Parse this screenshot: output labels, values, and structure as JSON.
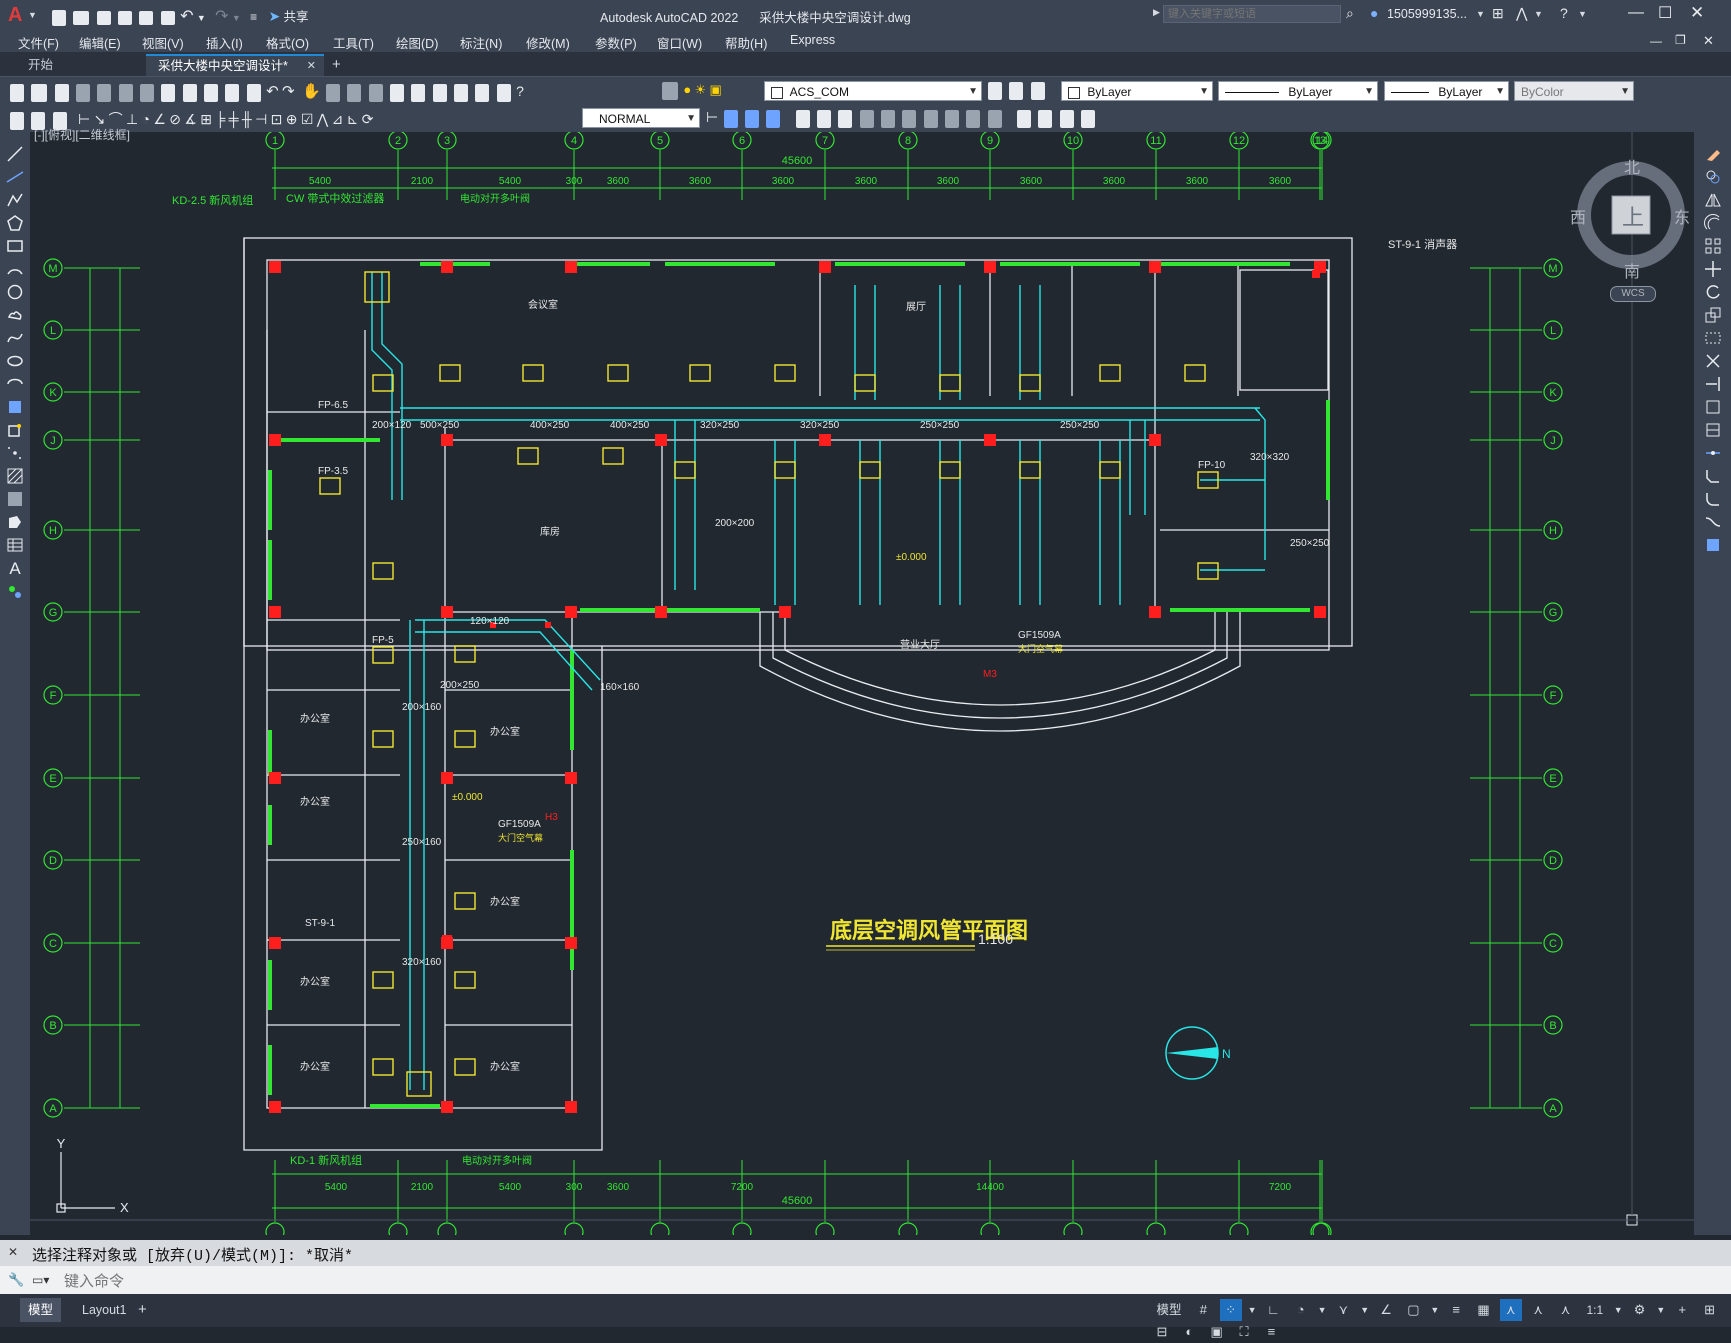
{
  "app": {
    "title": "Autodesk AutoCAD 2022",
    "file": "采供大楼中央空调设计.dwg",
    "share_label": "共享",
    "search_placeholder": "键入关键字或短语",
    "user": "1505999135...",
    "logo": "A"
  },
  "menu": [
    "文件(F)",
    "编辑(E)",
    "视图(V)",
    "插入(I)",
    "格式(O)",
    "工具(T)",
    "绘图(D)",
    "标注(N)",
    "修改(M)",
    "参数(P)",
    "窗口(W)",
    "帮助(H)",
    "Express"
  ],
  "tabs": {
    "start": "开始",
    "active": "采供大楼中央空调设计*",
    "add": "+"
  },
  "toolbar": {
    "layer": "ACS_COM",
    "color": "ByLayer",
    "linetype": "ByLayer",
    "lineweight": "ByLayer",
    "plotstyle": "ByColor",
    "textstyle": "NORMAL"
  },
  "viewport": {
    "label": "[-][俯视][二维线框]",
    "viewcube_top": "上",
    "north": "北",
    "south": "南",
    "east": "东",
    "west": "西",
    "wcs": "WCS",
    "ucs_x": "X",
    "ucs_y": "Y"
  },
  "drawing": {
    "title": "底层空调风管平面图",
    "scale": "1:100",
    "overall_dim": "45600",
    "top_dims": [
      "5400",
      "2100",
      "5400",
      "300",
      "3600",
      "3600",
      "3600",
      "3600",
      "3600",
      "3600",
      "3600",
      "3600",
      "3600"
    ],
    "bottom_dims": [
      "5400",
      "2100",
      "5400",
      "300",
      "3600",
      "7200",
      "14400",
      "7200"
    ],
    "col_axes": [
      "1",
      "2",
      "3",
      "4",
      "5",
      "6",
      "7",
      "8",
      "9",
      "10",
      "11",
      "12",
      "13",
      "14"
    ],
    "row_axes": [
      "M",
      "L",
      "K",
      "J",
      "H",
      "G",
      "F",
      "E",
      "D",
      "C",
      "B",
      "A"
    ],
    "labels": {
      "kd25": "KD-2.5 新风机组",
      "cw": "CW 带式中效过滤器",
      "valve": "电动对开多叶阀",
      "st91": "ST-9-1 消声器",
      "kd1": "KD-1 新风机组",
      "valve2": "电动对开多叶阀",
      "gf1": "GF1509A",
      "gf1_desc": "大门空气幕",
      "gf2": "GF1509A",
      "gf2_desc": "大门空气幕",
      "m3": "M3",
      "h3": "H3",
      "elev1": "±0.000",
      "elev2": "±0.000",
      "fp65": "FP-6.5",
      "fp5": "FP-5",
      "fp35": "FP-3.5",
      "fp10": "FP-10",
      "st91b": "ST-9-1",
      "lobby": "营业大厅",
      "rooms": [
        "办公室",
        "办公室",
        "办公室",
        "办公室",
        "办公室",
        "办公室",
        "办公室",
        "会议室",
        "库房",
        "展厅"
      ]
    },
    "ducts": [
      "500×250",
      "400×250",
      "400×250",
      "320×250",
      "320×250",
      "250×250",
      "250×250",
      "200×200",
      "200×120",
      "120×120",
      "200×160",
      "250×160",
      "320×160",
      "320×320",
      "250×250",
      "160×160",
      "200×250"
    ]
  },
  "command": {
    "history": "选择注释对象或 [放弃(U)/模式(M)]: *取消*",
    "placeholder": "键入命令"
  },
  "status": {
    "model_tab": "模型",
    "layout_tab": "Layout1",
    "add": "+",
    "model_btn": "模型",
    "scale": "1:1"
  },
  "colors": {
    "green": "#32e632",
    "cyan": "#28e6e6",
    "red": "#ff1e1e",
    "yellow": "#f0e632",
    "white": "#e8e8e8",
    "canvas": "#212830"
  }
}
